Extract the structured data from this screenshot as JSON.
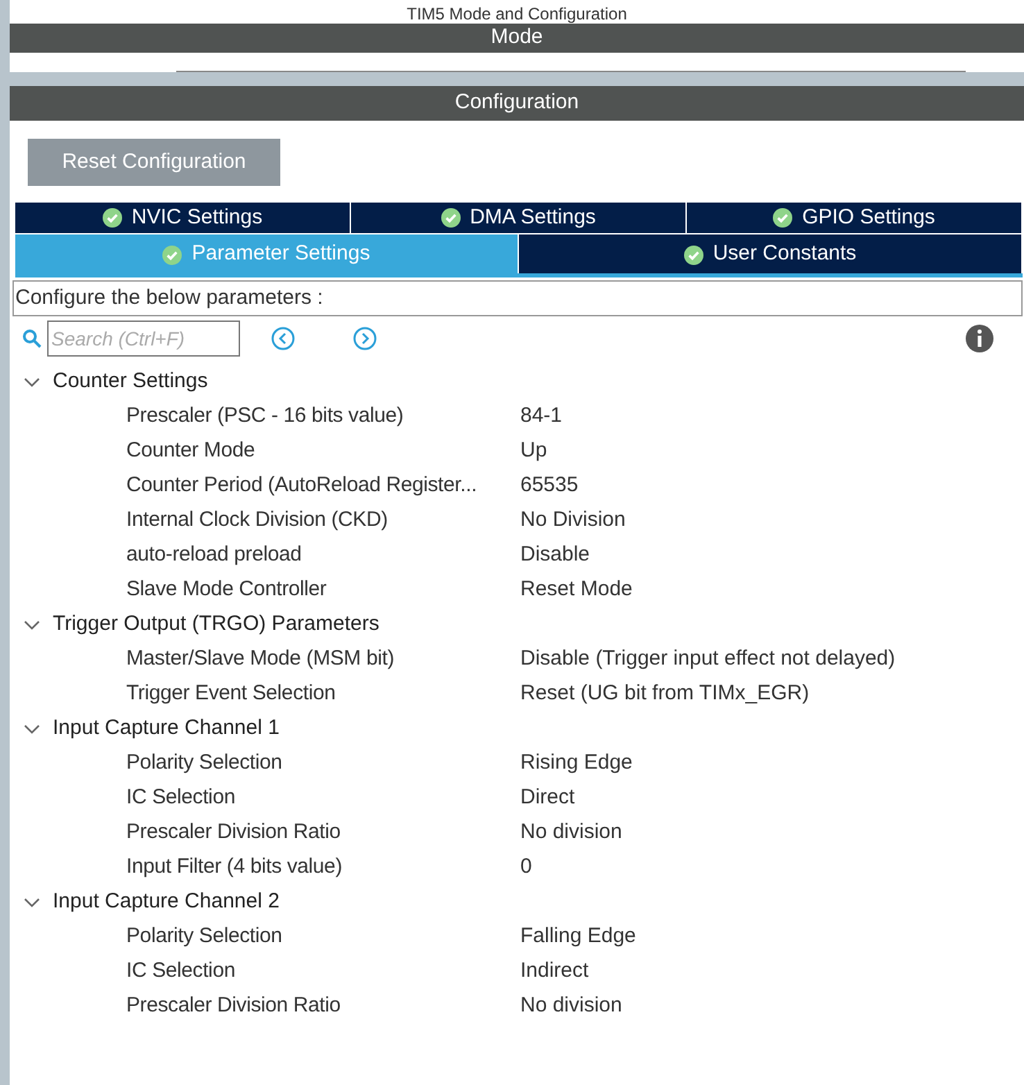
{
  "window": {
    "title": "TIM5 Mode and Configuration"
  },
  "mode_panel": {
    "title": "Mode"
  },
  "configuration_panel": {
    "title": "Configuration",
    "reset_button": "Reset Configuration"
  },
  "tab_rows": [
    [
      {
        "label": "NVIC Settings",
        "selected": false
      },
      {
        "label": "DMA Settings",
        "selected": false
      },
      {
        "label": "GPIO Settings",
        "selected": false
      }
    ],
    [
      {
        "label": "Parameter Settings",
        "selected": true
      },
      {
        "label": "User Constants",
        "selected": false
      }
    ]
  ],
  "description": "Configure the below parameters :",
  "search": {
    "placeholder": "Search (Ctrl+F)"
  },
  "groups": [
    {
      "title": "Counter Settings",
      "expanded": true,
      "children": [
        {
          "name": "Prescaler (PSC - 16 bits value)",
          "value": "84-1"
        },
        {
          "name": "Counter Mode",
          "value": "Up"
        },
        {
          "name": "Counter Period (AutoReload Register...",
          "value": "65535"
        },
        {
          "name": "Internal Clock Division (CKD)",
          "value": "No Division"
        },
        {
          "name": "auto-reload preload",
          "value": "Disable"
        },
        {
          "name": "Slave Mode Controller",
          "value": "Reset Mode"
        }
      ]
    },
    {
      "title": "Trigger Output (TRGO) Parameters",
      "expanded": true,
      "children": [
        {
          "name": "Master/Slave Mode (MSM bit)",
          "value": "Disable (Trigger input effect not delayed)"
        },
        {
          "name": "Trigger Event Selection",
          "value": "Reset (UG bit from TIMx_EGR)"
        }
      ]
    },
    {
      "title": "Input Capture Channel 1",
      "expanded": true,
      "children": [
        {
          "name": "Polarity Selection",
          "value": "Rising Edge"
        },
        {
          "name": "IC Selection",
          "value": "Direct"
        },
        {
          "name": "Prescaler Division Ratio",
          "value": "No division"
        },
        {
          "name": "Input Filter (4 bits value)",
          "value": "0"
        }
      ]
    },
    {
      "title": "Input Capture Channel 2",
      "expanded": true,
      "children": [
        {
          "name": "Polarity Selection",
          "value": "Falling Edge"
        },
        {
          "name": "IC Selection",
          "value": "Indirect"
        },
        {
          "name": "Prescaler Division Ratio",
          "value": "No division"
        }
      ]
    }
  ]
}
